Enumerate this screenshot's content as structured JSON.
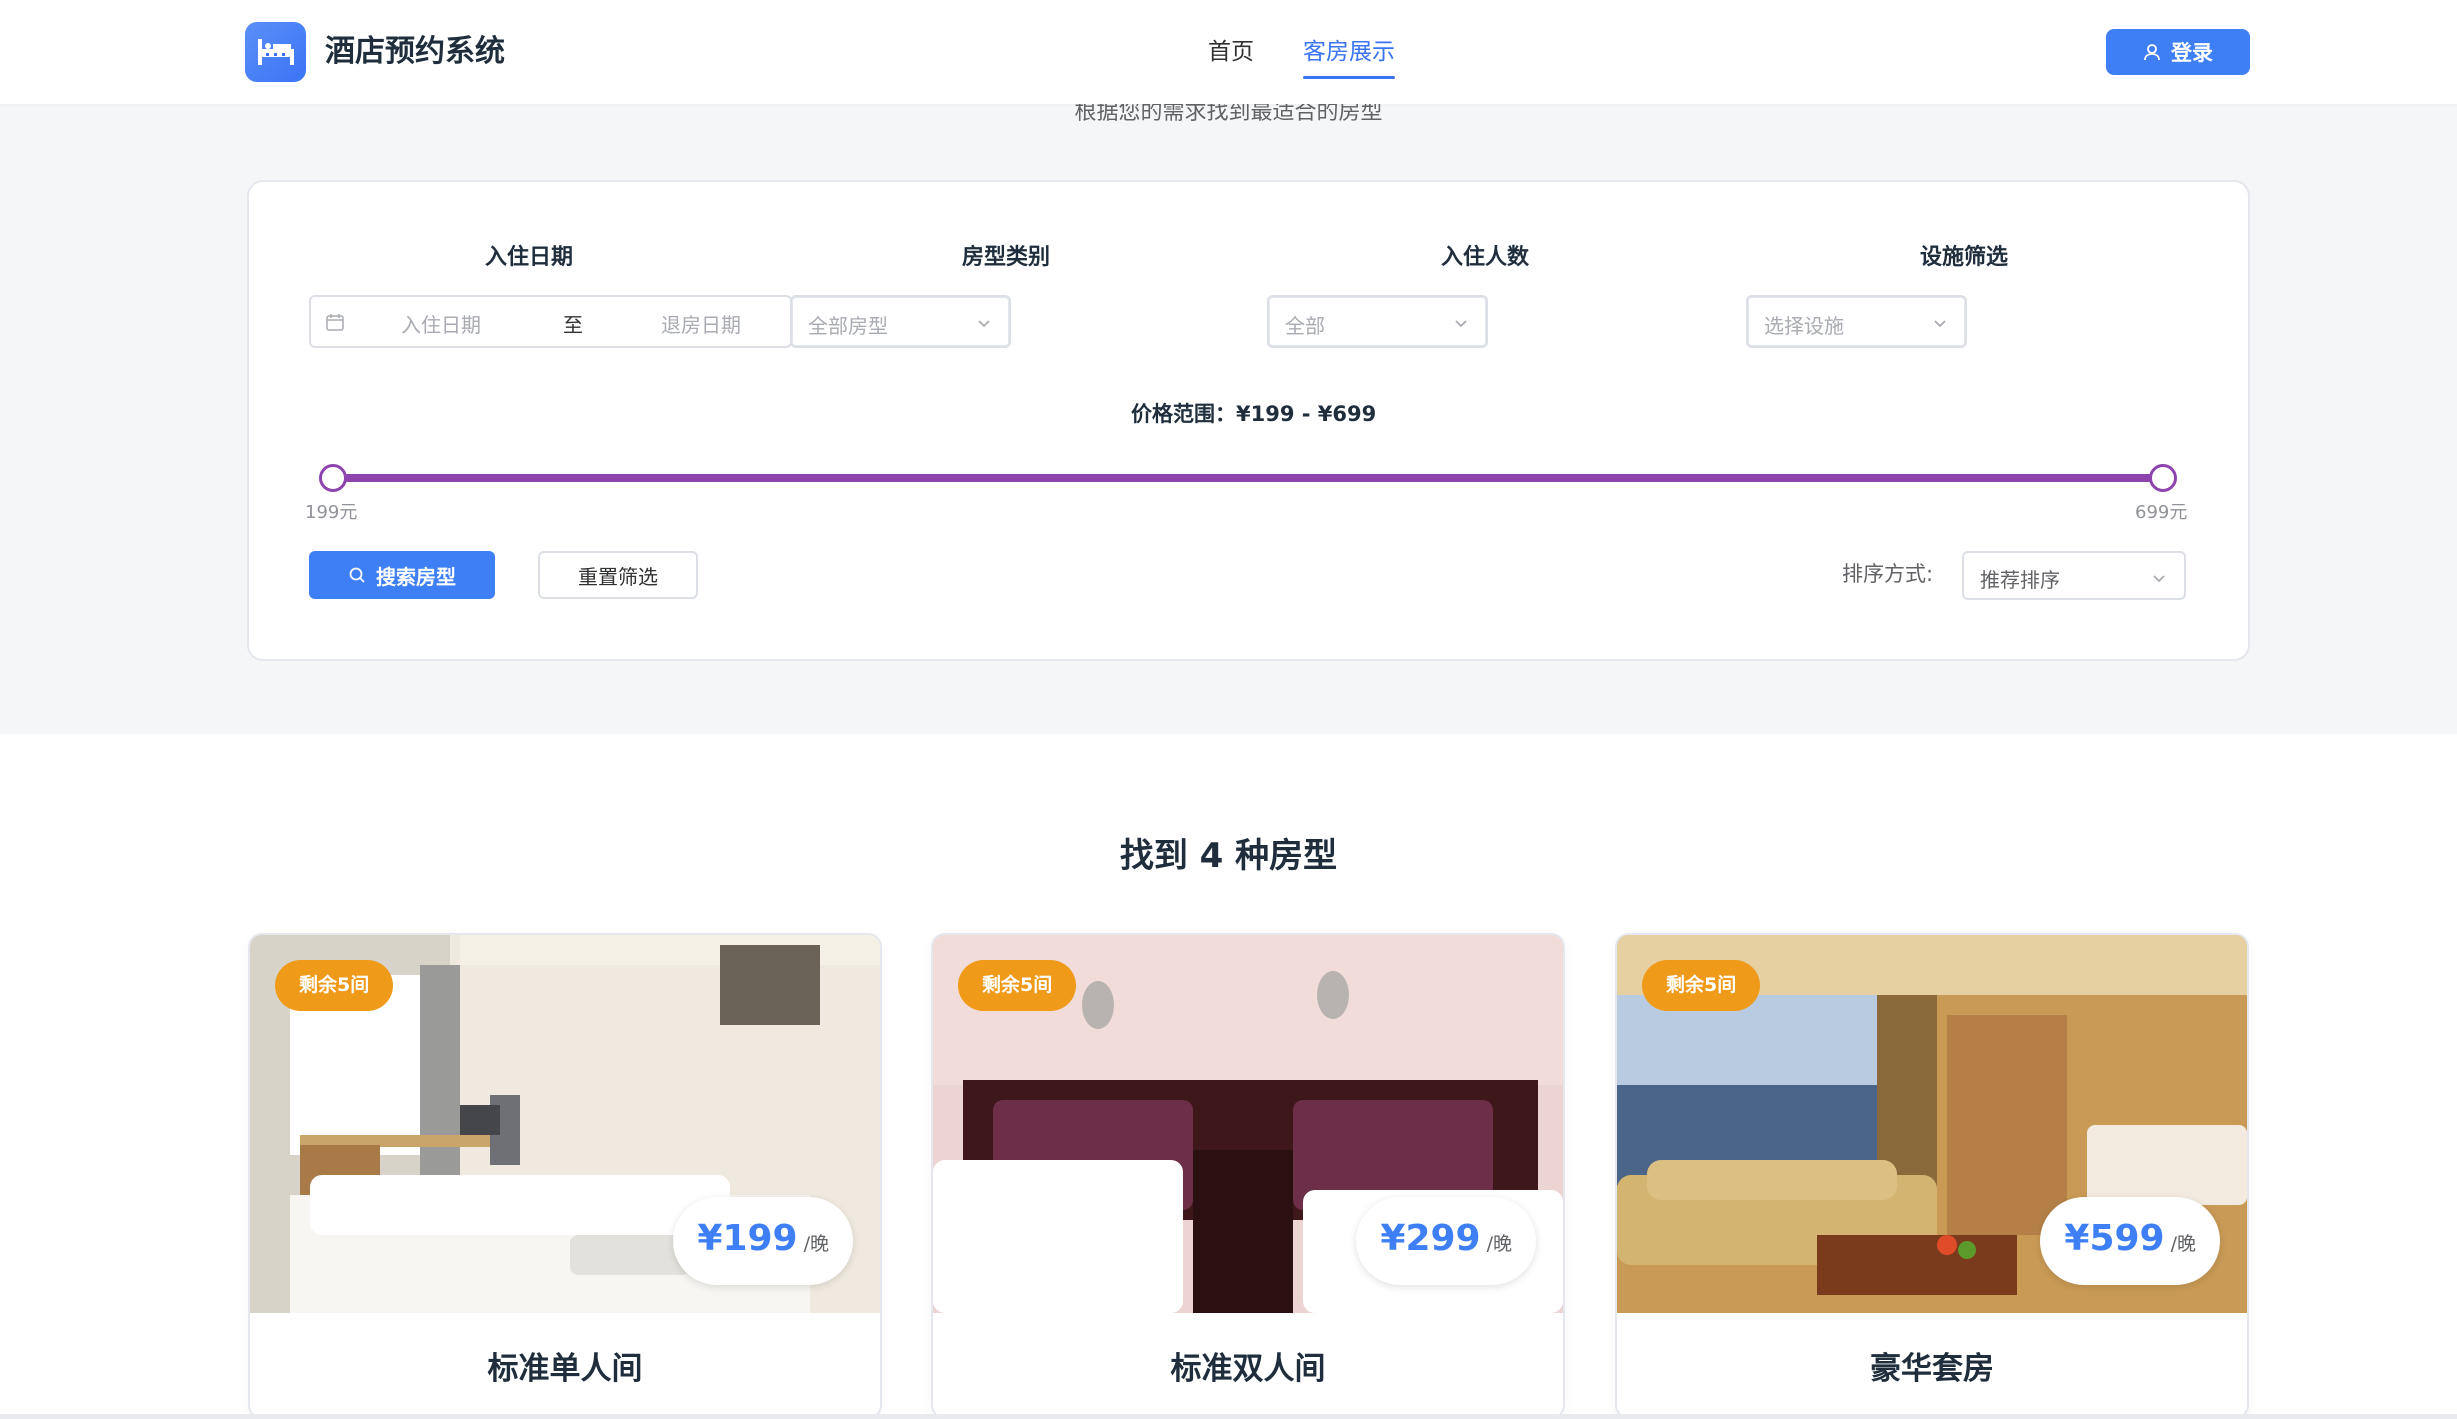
{
  "app": {
    "title": "酒店预约系统",
    "login_label": "登录"
  },
  "nav": {
    "home": "首页",
    "rooms": "客房展示"
  },
  "filter": {
    "subtitle": "根据您的需求找到最适合的房型",
    "date_label": "入住日期",
    "date_start_placeholder": "入住日期",
    "date_separator": "至",
    "date_end_placeholder": "退房日期",
    "type_label": "房型类别",
    "type_placeholder": "全部房型",
    "people_label": "入住人数",
    "people_placeholder": "全部",
    "facility_label": "设施筛选",
    "facility_placeholder": "选择设施",
    "price_label": "价格范围：¥199 - ¥699",
    "price_min": 199,
    "price_max": 699,
    "price_min_text": "199元",
    "price_max_text": "699元",
    "search_label": "搜索房型",
    "reset_label": "重置筛选",
    "sort_label": "排序方式:",
    "sort_value": "推荐排序",
    "accent_color": "#3e7ff6",
    "slider_color": "#8e44ad"
  },
  "results": {
    "title": "找到 4 种房型",
    "rooms": [
      {
        "name": "标准单人间",
        "price": "¥199",
        "unit": "/晚",
        "badge": "剩余5间"
      },
      {
        "name": "标准双人间",
        "price": "¥299",
        "unit": "/晚",
        "badge": "剩余5间"
      },
      {
        "name": "豪华套房",
        "price": "¥599",
        "unit": "/晚",
        "badge": "剩余5间"
      }
    ],
    "badge_color": "#f09a1a"
  }
}
